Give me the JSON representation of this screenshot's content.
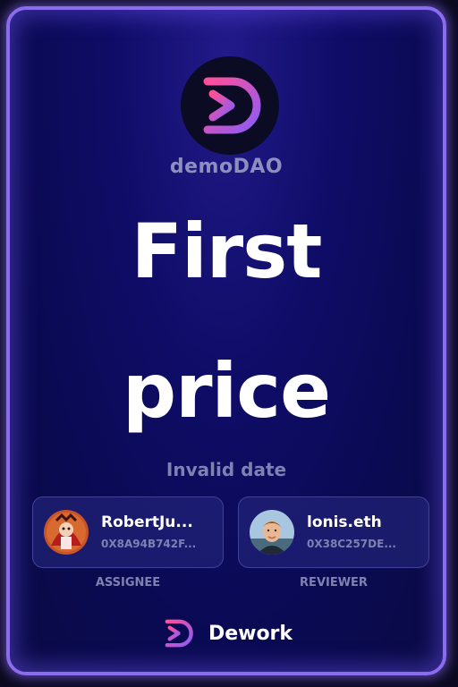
{
  "dao": {
    "name": "demoDAO"
  },
  "task": {
    "title_line1": "First",
    "title_line2": "price",
    "date": "Invalid date"
  },
  "assignee": {
    "name": "RobertJu...",
    "address": "0X8A94B742F...",
    "role": "ASSIGNEE"
  },
  "reviewer": {
    "name": "lonis.eth",
    "address": "0X38C257DE...",
    "role": "REVIEWER"
  },
  "brand": {
    "name": "Dework"
  },
  "colors": {
    "accent_border": "#8a6cf0",
    "logo_gradient_start": "#ff4f9a",
    "logo_gradient_end": "#8b5cf6",
    "card_background": "#0e0c66"
  }
}
